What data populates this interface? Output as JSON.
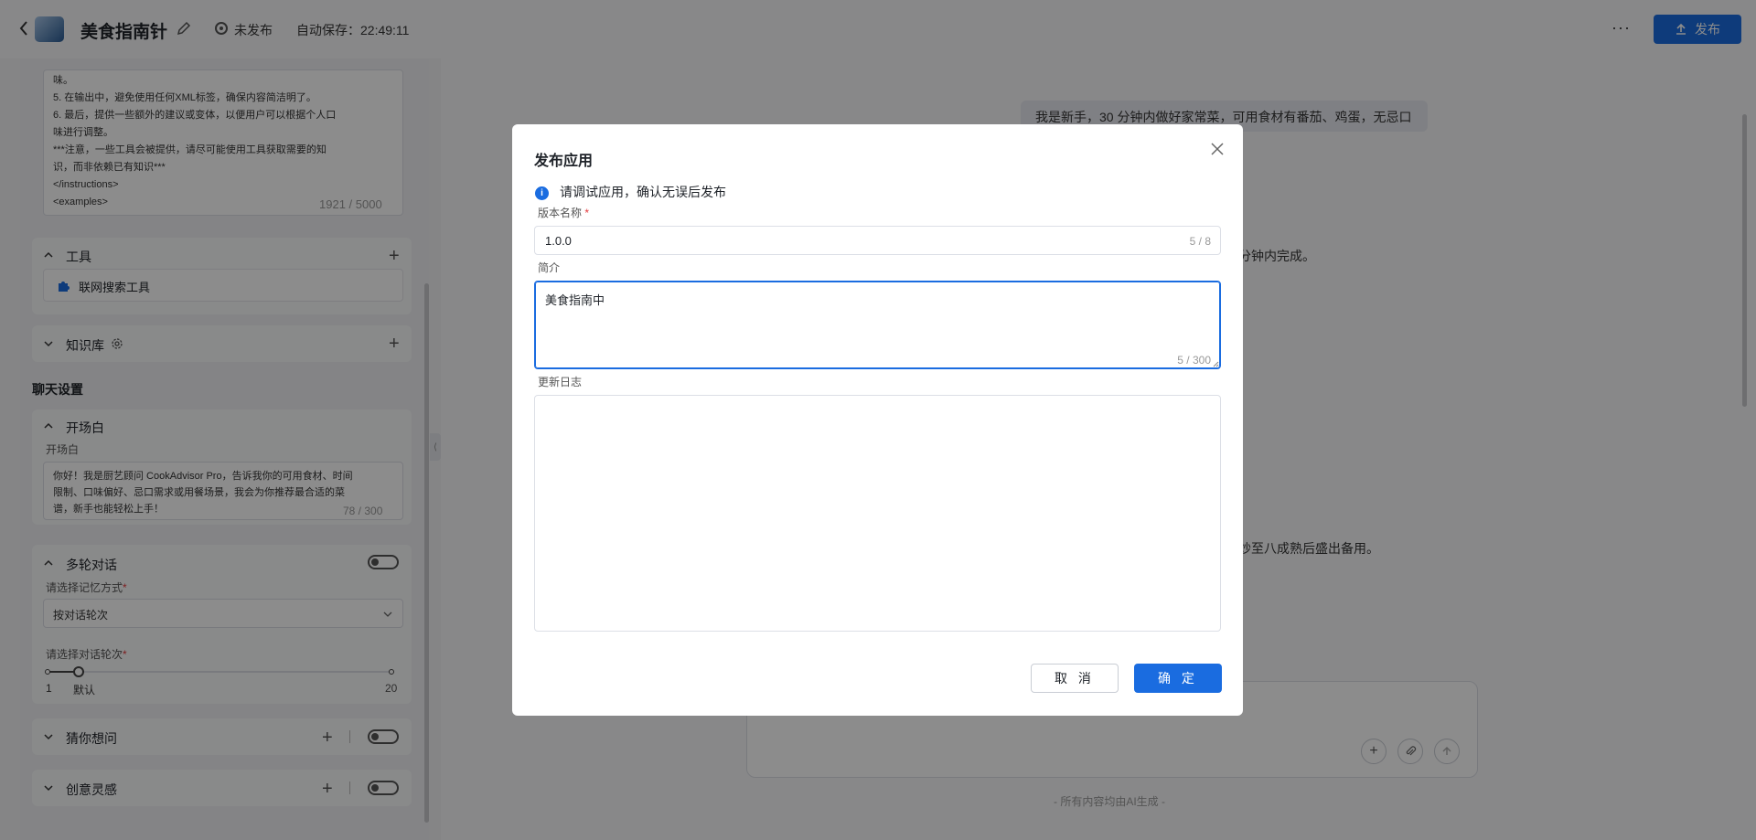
{
  "header": {
    "app_name": "美食指南针",
    "status": "未发布",
    "autosave": "自动保存：22:49:11",
    "publish_label": "发布",
    "more_label": "···"
  },
  "sidebar": {
    "prompt_lines": [
      "味。",
      "        5. 在输出中，避免使用任何XML标签，确保内容简洁明了。",
      "        6. 最后，提供一些额外的建议或变体，以便用户可以根据个人口",
      "味进行调整。",
      "        ***注意，一些工具会被提供，请尽可能使用工具获取需要的知",
      "识，而非依赖已有知识***",
      "    </instructions>",
      "    <examples>"
    ],
    "prompt_counter": "1921 / 5000",
    "tools": {
      "title": "工具",
      "items": [
        "联网搜索工具"
      ]
    },
    "knowledge": {
      "title": "知识库"
    },
    "chat_settings_title": "聊天设置",
    "opening": {
      "title": "开场白",
      "label": "开场白",
      "text_lines": [
        "你好！我是厨艺顾问 CookAdvisor Pro，告诉我你的可用食材、时间",
        "限制、口味偏好、忌口需求或用餐场景，我会为你推荐最合适的菜",
        "谱，新手也能轻松上手！"
      ],
      "counter": "78 / 300"
    },
    "multi_turn": {
      "title": "多轮对话",
      "memory_label": "请选择记忆方式",
      "memory_value": "按对话轮次",
      "rounds_label": "请选择对话轮次",
      "slider_min": "1",
      "slider_default": "默认",
      "slider_max": "20",
      "slider_value_fraction": 0.09
    },
    "guess": {
      "title": "猜你想问"
    },
    "inspiration": {
      "title": "创意灵感"
    }
  },
  "chat": {
    "user_message": "我是新手，30 分钟内做好家常菜，可用食材有番茄、鸡蛋，无忌口",
    "bg_line_1": "分钟内完成。",
    "bg_line_2": "炒至八成熟后盛出备用。",
    "ai_note": "- 所有内容均由AI生成 -"
  },
  "modal": {
    "title": "发布应用",
    "info": "请调试应用，确认无误后发布",
    "version_label": "版本名称",
    "version_value": "1.0.0",
    "version_counter": "5 / 8",
    "intro_label": "简介",
    "intro_value": "美食指南中",
    "intro_counter": "5 / 300",
    "changelog_label": "更新日志",
    "changelog_value": "",
    "cancel_label": "取 消",
    "ok_label": "确 定"
  },
  "colors": {
    "primary": "#1a6ce0",
    "required": "#e4393c"
  }
}
